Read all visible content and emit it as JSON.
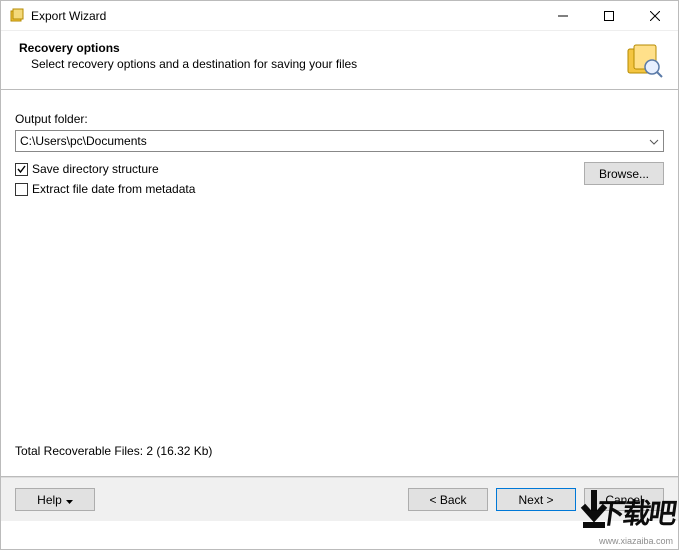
{
  "window": {
    "title": "Export Wizard"
  },
  "header": {
    "title": "Recovery options",
    "subtitle": "Select recovery options and a destination for saving your files"
  },
  "content": {
    "output_label": "Output folder:",
    "output_path": "C:\\Users\\pc\\Documents",
    "save_dir_label": "Save directory structure",
    "save_dir_checked": true,
    "extract_meta_label": "Extract file date from metadata",
    "extract_meta_checked": false,
    "browse_label": "Browse...",
    "status": "Total Recoverable Files: 2 (16.32 Kb)"
  },
  "footer": {
    "help_label": "Help",
    "back_label": "< Back",
    "next_label": "Next >",
    "cancel_label": "Cancel"
  },
  "watermark": {
    "big": "下载吧",
    "url": "www.xiazaiba.com"
  }
}
